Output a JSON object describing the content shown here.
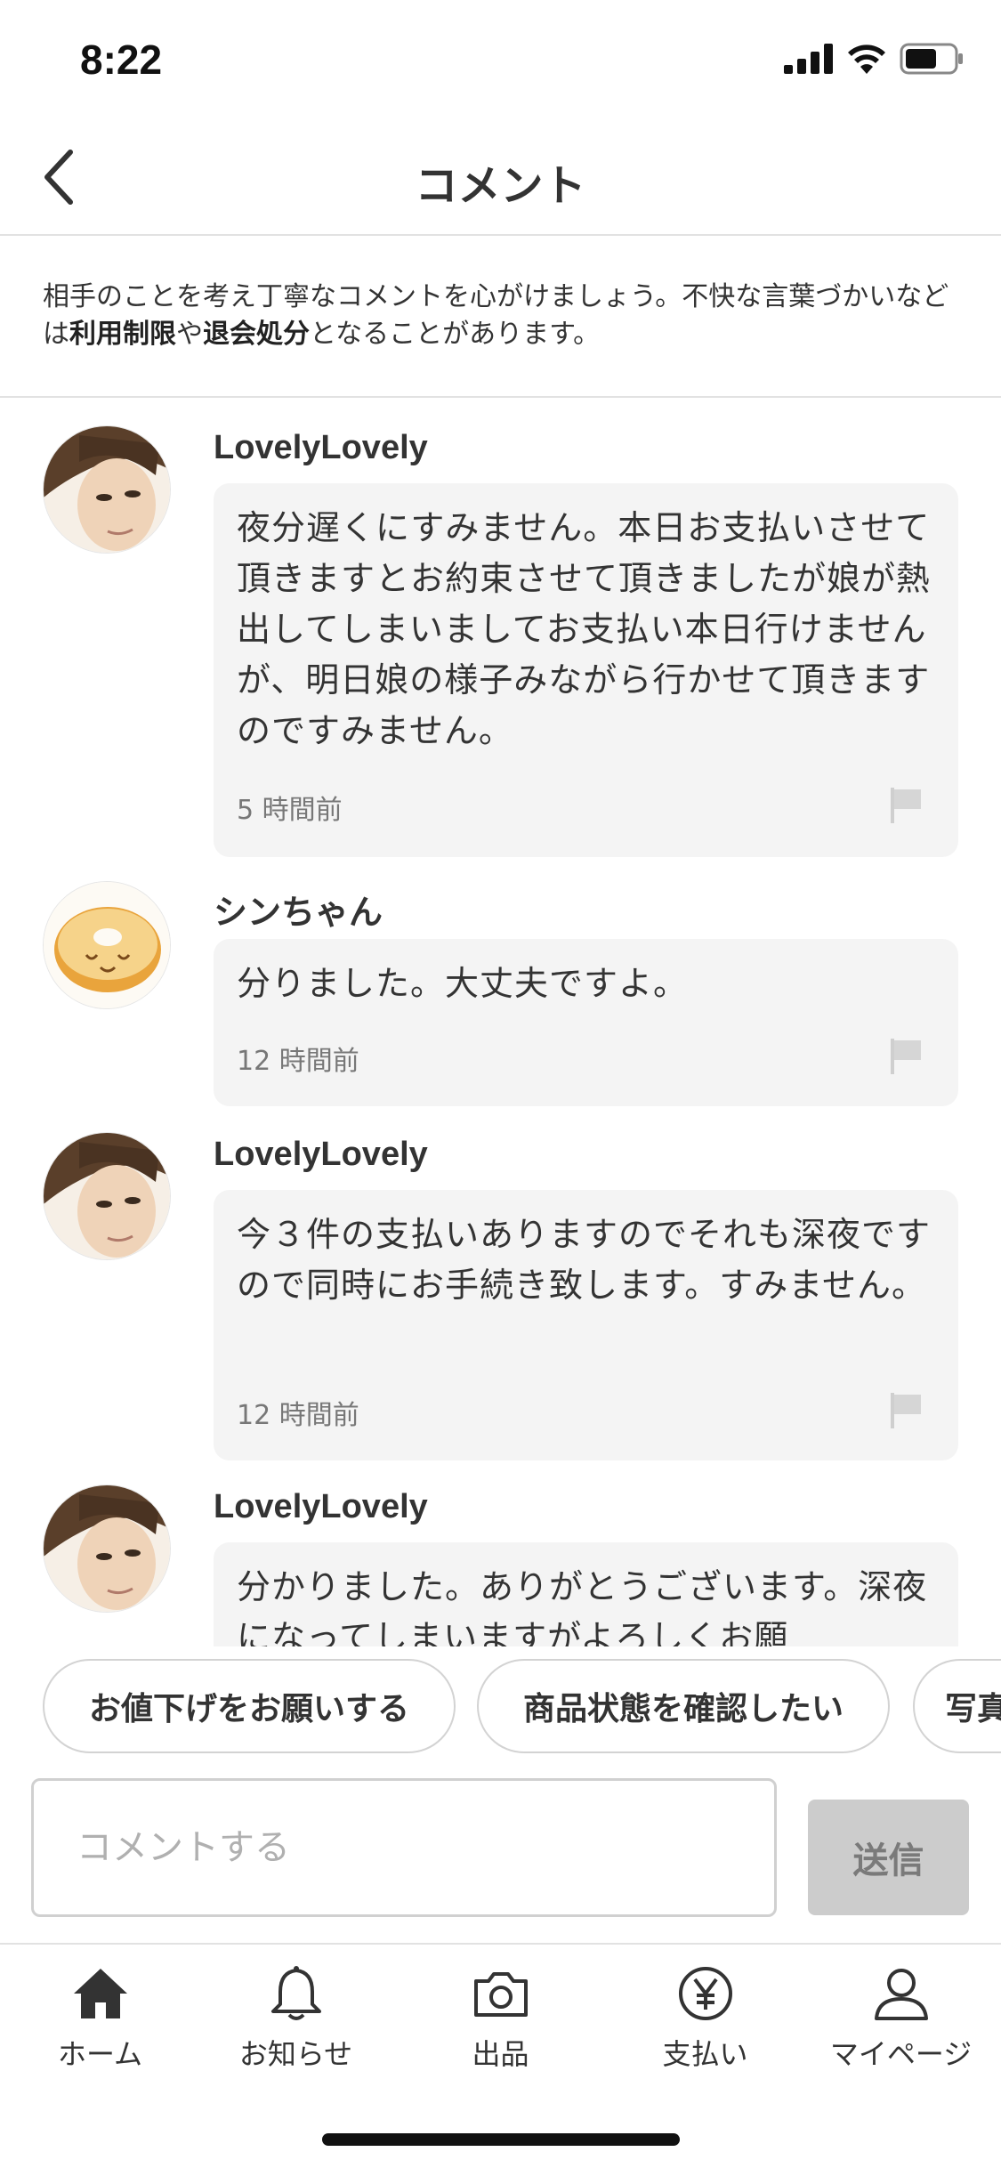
{
  "status_bar": {
    "time": "8:22"
  },
  "header": {
    "title": "コメント",
    "back_icon": "chevron-left-icon"
  },
  "notice": {
    "part1": "相手のことを考え丁寧なコメントを心がけましょう。不快な言葉づかいなどは",
    "bold1": "利用制限",
    "part2": "や",
    "bold2": "退会処分",
    "part3": "となることがあります。"
  },
  "comments": [
    {
      "username": "LovelyLovely",
      "avatar": "portrait-avatar",
      "text": "夜分遅くにすみません。本日お支払いさせて頂きますとお約束させて頂きましたが娘が熱出してしまいましてお支払い本日行けませんが、明日娘の様子みながら行かせて頂きますのですみません。",
      "time": "5 時間前"
    },
    {
      "username": "シンちゃん",
      "avatar": "baumkuchen-avatar",
      "text": "分りました。大丈夫ですよ。",
      "time": "12 時間前"
    },
    {
      "username": "LovelyLovely",
      "avatar": "portrait-avatar",
      "text": "今３件の支払いありますのでそれも深夜ですので同時にお手続き致します。すみません。",
      "time": "12 時間前"
    },
    {
      "username": "LovelyLovely",
      "avatar": "portrait-avatar",
      "text": "分かりました。ありがとうございます。深夜になってしまいますがよろしくお願"
    }
  ],
  "quick_replies": [
    "お値下げをお願いする",
    "商品状態を確認したい",
    "写真"
  ],
  "composer": {
    "placeholder": "コメントする",
    "send_label": "送信"
  },
  "tab_bar": [
    {
      "label": "ホーム",
      "icon": "home-icon"
    },
    {
      "label": "お知らせ",
      "icon": "bell-icon"
    },
    {
      "label": "出品",
      "icon": "camera-icon"
    },
    {
      "label": "支払い",
      "icon": "yen-icon"
    },
    {
      "label": "マイページ",
      "icon": "person-icon"
    }
  ],
  "colors": {
    "bubble": "#f4f4f4",
    "divider": "#e2e2e2",
    "send_button": "#cccccc",
    "text": "#333333"
  }
}
